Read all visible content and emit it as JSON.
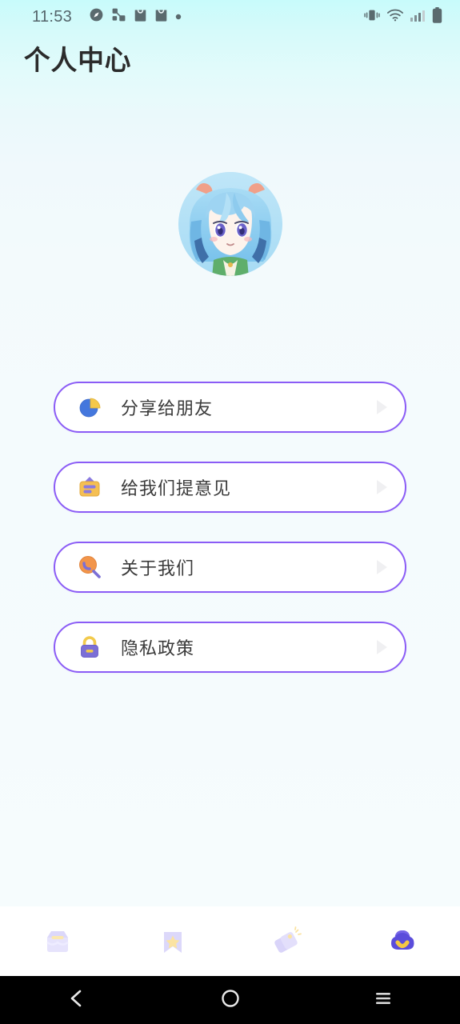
{
  "status_bar": {
    "time": "11:53",
    "left_icons": [
      "compass-icon",
      "share-network-icon",
      "shopping-bag-icon",
      "shopping-bag-icon",
      "dot-icon"
    ],
    "right_icons": [
      "vibrate-icon",
      "wifi-icon",
      "signal-icon",
      "battery-icon"
    ],
    "text_color": "#54646a"
  },
  "header": {
    "title": "个人中心"
  },
  "profile": {
    "avatar_alt": "anime-character-avatar",
    "avatar_bg": "#bfe4f7"
  },
  "menu": {
    "accent_color": "#8b5cf6",
    "items": [
      {
        "label": "分享给朋友",
        "icon": "share-pie-icon",
        "arrow": "chevron-right-icon"
      },
      {
        "label": "给我们提意见",
        "icon": "feedback-board-icon",
        "arrow": "chevron-right-icon"
      },
      {
        "label": "关于我们",
        "icon": "magnifier-icon",
        "arrow": "chevron-right-icon"
      },
      {
        "label": "隐私政策",
        "icon": "lock-icon",
        "arrow": "chevron-right-icon"
      }
    ]
  },
  "tabbar": {
    "inactive_color": "#d8d4f7",
    "active_color": "#5b4ddb",
    "accent_color": "#f5c842",
    "tabs": [
      {
        "name": "inbox-tab",
        "icon": "inbox-box-icon",
        "active": false
      },
      {
        "name": "favorites-tab",
        "icon": "bookmark-star-icon",
        "active": false
      },
      {
        "name": "tags-tab",
        "icon": "price-tags-icon",
        "active": false
      },
      {
        "name": "profile-tab",
        "icon": "cloud-face-icon",
        "active": true
      }
    ]
  },
  "android_nav": {
    "buttons": [
      {
        "name": "back-button",
        "icon": "chevron-left-icon"
      },
      {
        "name": "home-button",
        "icon": "circle-icon"
      },
      {
        "name": "recents-button",
        "icon": "hamburger-icon"
      }
    ]
  }
}
